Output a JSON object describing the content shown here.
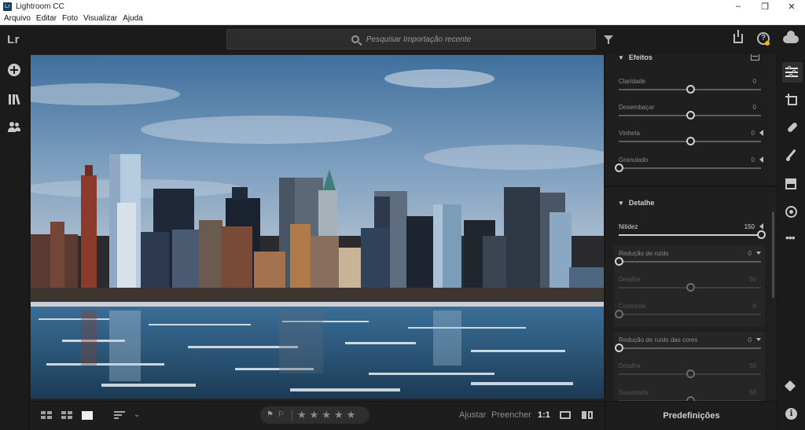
{
  "window": {
    "title": "Lightroom CC",
    "app_icon_text": "Lr",
    "controls": [
      "–",
      "❐",
      "✕"
    ]
  },
  "menu": [
    "Arquivo",
    "Editar",
    "Foto",
    "Visualizar",
    "Ajuda"
  ],
  "topbar": {
    "logo": "Lr",
    "search_placeholder": "Pesquisar Importação recente"
  },
  "bottombar": {
    "ajustar": "Ajustar",
    "preencher": "Preencher",
    "one_to_one": "1:1",
    "stars": [
      "★",
      "★",
      "★",
      "★",
      "★"
    ]
  },
  "panel": {
    "efeitos": {
      "title": "Efeitos",
      "sliders": [
        {
          "label": "Claridade",
          "value": "0",
          "level": 0.5
        },
        {
          "label": "Desembaçar",
          "value": "0",
          "level": 0.5
        },
        {
          "label": "Vinheta",
          "value": "0",
          "level": 0.5
        },
        {
          "label": "Granulado",
          "value": "0",
          "level": 0.0
        }
      ]
    },
    "detalhe": {
      "title": "Detalhe",
      "nitidez": {
        "label": "Nitidez",
        "value": "150",
        "level": 1.0
      },
      "reducao_ruido": {
        "label": "Redução de ruído",
        "value": "0",
        "level": 0.0,
        "detalhe": {
          "label": "Detalhe",
          "value": "50",
          "level": 0.5
        },
        "contraste": {
          "label": "Contraste",
          "value": "0",
          "level": 0.0
        }
      },
      "reducao_cores": {
        "label": "Redução de ruído das cores",
        "value": "0",
        "level": 0.0,
        "detalhe": {
          "label": "Detalhe",
          "value": "50",
          "level": 0.5
        },
        "suavidade": {
          "label": "Suavidade",
          "value": "50",
          "level": 0.5
        }
      }
    }
  },
  "presets": {
    "label": "Predefinições"
  },
  "colors": {
    "accent_badge": "#ffb400",
    "background": "#1d1d1d",
    "panel": "#1f1f1f"
  }
}
